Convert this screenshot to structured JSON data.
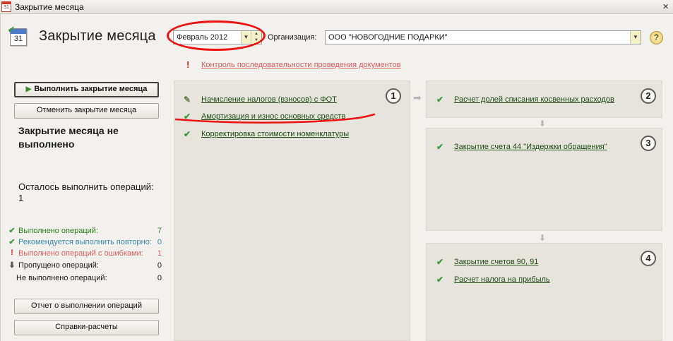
{
  "window": {
    "title": "Закрытие месяца",
    "close_glyph": "×",
    "icon": "calendar-31-icon"
  },
  "header": {
    "title": "Закрытие месяца",
    "calendar_day": "31",
    "period": "Февраль 2012",
    "org_label": "Организация:",
    "organization": "ООО \"НОВОГОДНИЕ ПОДАРКИ\"",
    "help_label": "?"
  },
  "control_link": "Контроль последовательности проведения документов",
  "left": {
    "run_button": "Выполнить закрытие месяца",
    "cancel_button": "Отменить закрытие месяца",
    "status_title": "Закрытие месяца не выполнено",
    "remaining": "Осталось выполнить операций: 1",
    "stats": [
      {
        "label": "Выполнено операций:",
        "count": "7",
        "color": "#2e7d1a",
        "icon": "check-icon"
      },
      {
        "label": "Рекомендуется выполнить повторно:",
        "count": "0",
        "color": "#3b8aa8",
        "icon": "check-icon"
      },
      {
        "label": "Выполнено операций с ошибками:",
        "count": "1",
        "color": "#d95d5d",
        "icon": "exclamation-icon"
      },
      {
        "label": "Пропущено операций:",
        "count": "0",
        "color": "#1a1a1a",
        "icon": "arrow-down-icon"
      },
      {
        "label": "Не выполнено операций:",
        "count": "0",
        "color": "#1a1a1a",
        "icon": ""
      }
    ],
    "report_button": "Отчет о выполнении операций",
    "calc_button": "Справки-расчеты"
  },
  "steps": [
    {
      "number": "1",
      "operations": [
        {
          "label": "Начисление налогов (взносов) с ФОТ",
          "icon": "edited-check-icon"
        },
        {
          "label": "Амортизация и износ основных средств",
          "icon": "check-icon"
        },
        {
          "label": "Корректировка стоимости номенклатуры",
          "icon": "check-icon"
        }
      ]
    },
    {
      "number": "2",
      "operations": [
        {
          "label": "Расчет долей списания косвенных расходов",
          "icon": "check-icon"
        }
      ]
    },
    {
      "number": "3",
      "operations": [
        {
          "label": "Закрытие счета 44 \"Издержки обращения\"",
          "icon": "check-icon"
        }
      ]
    },
    {
      "number": "4",
      "operations": [
        {
          "label": "Закрытие счетов 90, 91",
          "icon": "check-icon"
        },
        {
          "label": "Расчет налога на прибыль",
          "icon": "check-icon"
        }
      ]
    }
  ],
  "colors": {
    "panel": "#e7e4de",
    "link": "#1f4d11",
    "check": "#3a9a3a",
    "annotation": "#ee1111",
    "error": "#d95d5d"
  }
}
